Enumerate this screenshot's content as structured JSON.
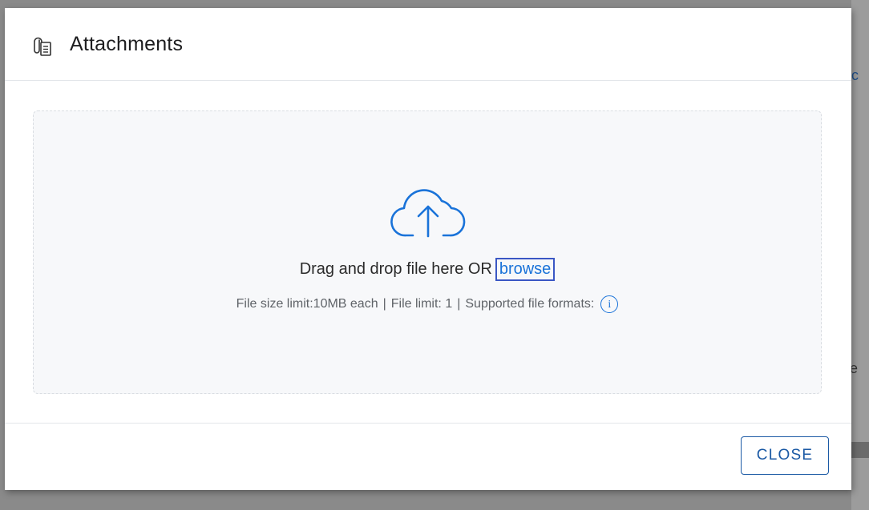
{
  "backdrop": {
    "fragment_top": "c",
    "fragment_mid": "e"
  },
  "modal": {
    "title": "Attachments",
    "header_icon": "paperclip-document-icon"
  },
  "dropzone": {
    "upload_icon": "cloud-upload-icon",
    "prompt_text": "Drag and drop file here OR",
    "browse_label": "browse",
    "size_limit": "File size limit:10MB each",
    "file_limit": "File limit: 1",
    "formats_label": "Supported file formats:",
    "separator": "|",
    "info_icon": "info-icon",
    "info_glyph": "i"
  },
  "footer": {
    "close_label": "CLOSE"
  },
  "colors": {
    "accent": "#1a73d9",
    "button_border": "#1c5aa5",
    "focus_outline": "#3a57c4"
  }
}
